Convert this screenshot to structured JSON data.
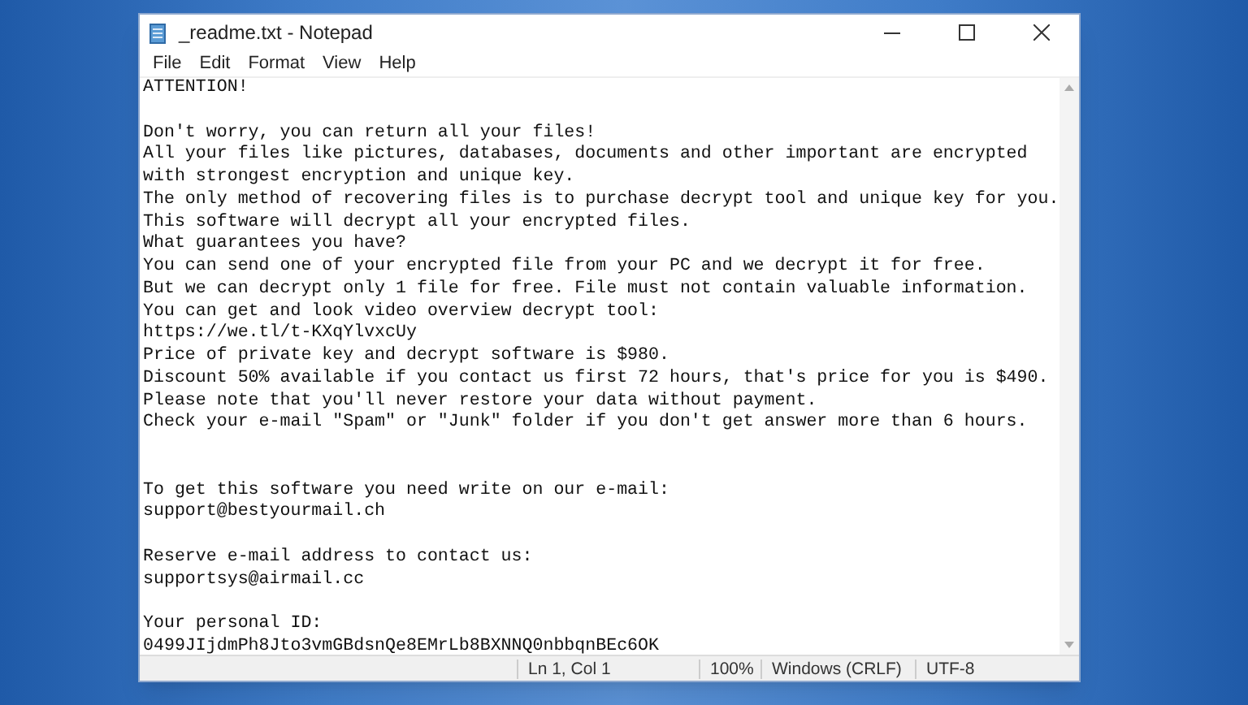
{
  "window": {
    "title": "_readme.txt - Notepad"
  },
  "menu": [
    "File",
    "Edit",
    "Format",
    "View",
    "Help"
  ],
  "document": {
    "lines": [
      {
        "kind": "text",
        "text": "ATTENTION!"
      },
      {
        "kind": "blank"
      },
      {
        "kind": "text",
        "text": "Don't worry, you can return all your files!"
      },
      {
        "kind": "text",
        "text": "All your files like pictures, databases, documents and other important are encrypted"
      },
      {
        "kind": "text",
        "text": "with strongest encryption and unique key."
      },
      {
        "kind": "text",
        "text": "The only method of recovering files is to purchase decrypt tool and unique key for you."
      },
      {
        "kind": "text",
        "text": "This software will decrypt all your encrypted files."
      },
      {
        "kind": "text",
        "text": "What guarantees you have?"
      },
      {
        "kind": "text",
        "text": "You can send one of your encrypted file from your PC and we decrypt it for free."
      },
      {
        "kind": "text",
        "text": "But we can decrypt only 1 file for free. File must not contain valuable information."
      },
      {
        "kind": "text",
        "text": "You can get and look video overview decrypt tool:"
      },
      {
        "kind": "text",
        "text": "https://we.tl/t-KXqYlvxcUy"
      },
      {
        "kind": "text",
        "text": "Price of private key and decrypt software is $980."
      },
      {
        "kind": "text",
        "text": "Discount 50% available if you contact us first 72 hours, that's price for you is $490."
      },
      {
        "kind": "text",
        "text": "Please note that you'll never restore your data without payment."
      },
      {
        "kind": "text",
        "text": "Check your e-mail \"Spam\" or \"Junk\" folder if you don't get answer more than 6 hours."
      },
      {
        "kind": "blank"
      },
      {
        "kind": "blank"
      },
      {
        "kind": "text",
        "text": "To get this software you need write on our e-mail:"
      },
      {
        "kind": "text",
        "text": "support@bestyourmail.ch"
      },
      {
        "kind": "blank"
      },
      {
        "kind": "text",
        "text": "Reserve e-mail address to contact us:"
      },
      {
        "kind": "text",
        "text": "supportsys@airmail.cc"
      },
      {
        "kind": "blank"
      },
      {
        "kind": "text",
        "text": "Your personal ID:"
      },
      {
        "kind": "text",
        "text": "0499JIjdmPh8Jto3vmGBdsnQe8EMrLb8BXNNQ0nbbqnBEc6OK"
      }
    ]
  },
  "status_bar": [
    "Ln 1, Col 1",
    "100%",
    "Windows (CRLF)",
    "UTF-8"
  ]
}
